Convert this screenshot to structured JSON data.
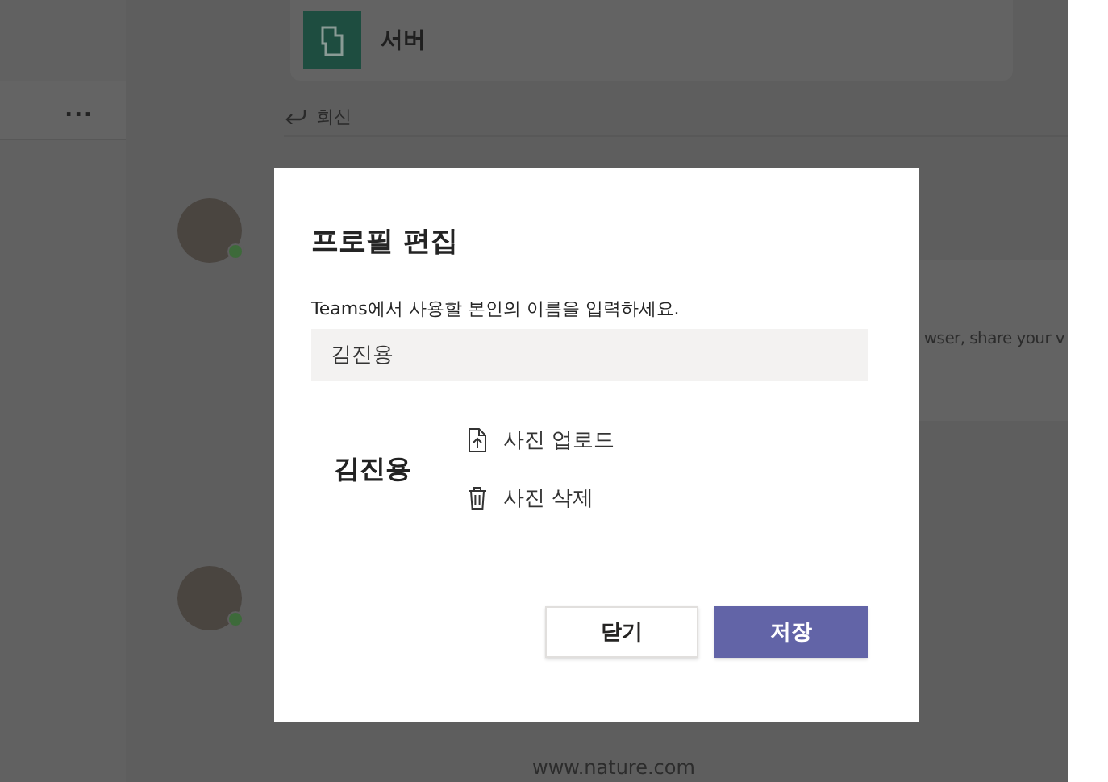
{
  "background": {
    "sidebar": {
      "more": "..."
    },
    "card": {
      "title": "서버"
    },
    "reply": "회신",
    "snippet": "wser, share your v",
    "link": "www.nature.com"
  },
  "dialog": {
    "title": "프로필 편집",
    "label": "Teams에서 사용할 본인의 이름을 입력하세요.",
    "name_value": "김진용",
    "display_name": "김진용",
    "actions": [
      {
        "kind": "upload",
        "label": "사진 업로드"
      },
      {
        "kind": "delete",
        "label": "사진 삭제"
      }
    ],
    "buttons": [
      {
        "label": "닫기",
        "primary": false
      },
      {
        "label": "저장",
        "primary": true
      }
    ]
  }
}
